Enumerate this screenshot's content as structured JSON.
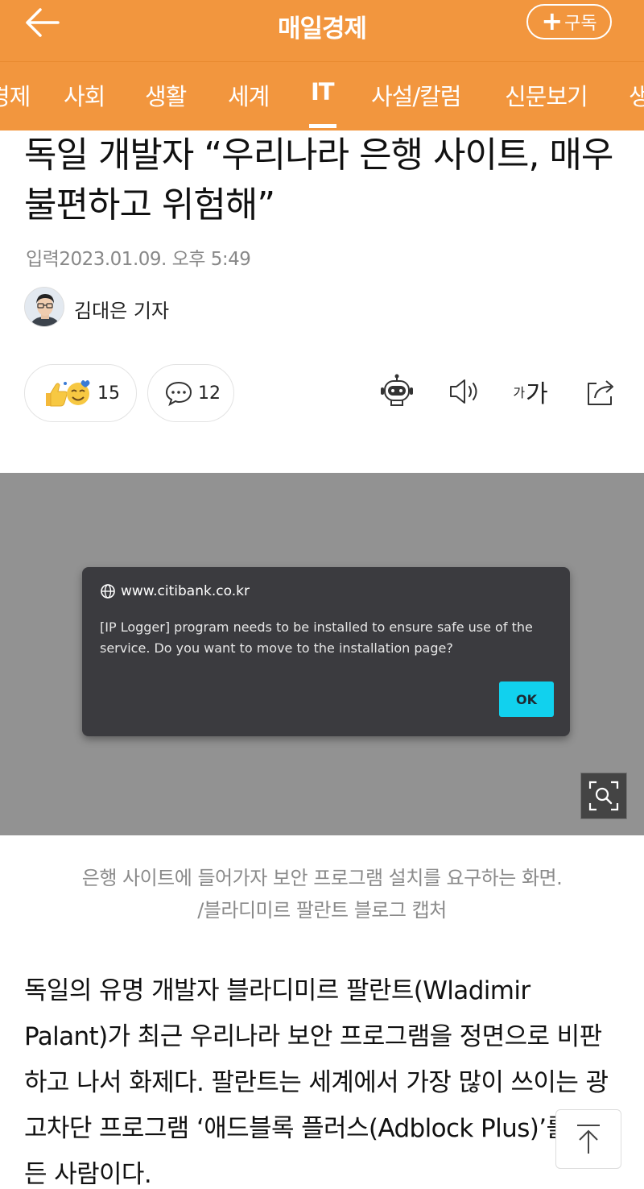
{
  "header": {
    "brand": "매일경제",
    "subscribe_label": "구독",
    "accent_color": "#f2963e"
  },
  "tabs": [
    {
      "label": "경제"
    },
    {
      "label": "사회"
    },
    {
      "label": "생활"
    },
    {
      "label": "세계"
    },
    {
      "label": "IT",
      "active": true
    },
    {
      "label": "사설/칼럼"
    },
    {
      "label": "신문보기"
    },
    {
      "label": "생활"
    }
  ],
  "article": {
    "title": "독일 개발자 “우리나라 은행 사이트, 매우 불편하고 위험해”",
    "date_label": "입력",
    "date": "2023.01.09. 오후 5:49",
    "author": "김대은 기자",
    "reactions": {
      "count": "15"
    },
    "comments": {
      "count": "12"
    },
    "font_size_label_small": "가",
    "font_size_label_large": "가"
  },
  "photo": {
    "dialog_host": "www.citibank.co.kr",
    "dialog_message": "[IP Logger] program needs to be installed to ensure safe use of the service. Do you want to move to the installation page?",
    "ok_label": "OK",
    "caption_line1": "은행 사이트에 들어가자 보안 프로그램 설치를 요구하는 화면.",
    "caption_line2": "/블라디미르 팔란트 블로그 캡처"
  },
  "body": {
    "paragraph": "독일의 유명 개발자 블라디미르 팔란트(Wladimir Palant)가 최근 우리나라 보안 프로그램을 정면으로 비판하고 나서 화제다. 팔란트는 세계에서 가장 많이 쓰이는 광고차단 프로그램 ‘애드블록 플러스(Adblock Plus)’를 만든 사람이다."
  }
}
